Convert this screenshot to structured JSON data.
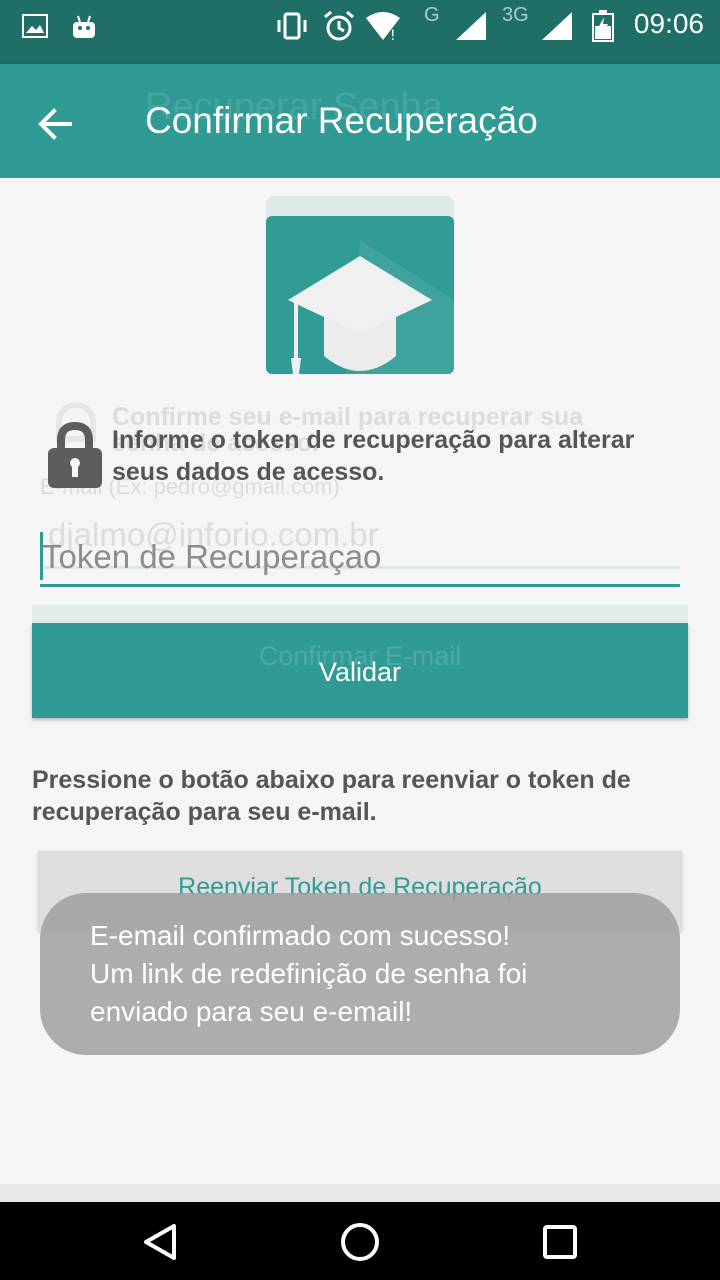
{
  "status_bar": {
    "time": "09:06",
    "network_g": "G",
    "network_3g": "3G",
    "icons": [
      "image-icon",
      "android-icon",
      "vibrate-icon",
      "alarm-icon",
      "wifi-icon",
      "signal-icon",
      "signal-icon",
      "battery-icon"
    ]
  },
  "app_bar": {
    "title": "Confirmar Recuperação",
    "ghost_title": "Recuperar Senha",
    "back_icon": "arrow-back-icon"
  },
  "ghost": {
    "confirm_text_line1": "Confirme seu e-mail para recuperar sua",
    "confirm_text_line2": "senha de acesso.",
    "email_hint": "E-mail (Ex: pedro@gmail.com)",
    "email_value": "djalmo@inforio.com.br",
    "confirm_button": "Confirmar E-mail"
  },
  "main": {
    "info_text": "Informe o token de recuperação para alterar seus dados de acesso.",
    "token_placeholder": "Token de Recuperaçao",
    "validate_button": "Validar",
    "resend_text": "Pressione o botão abaixo para reenviar o token de recuperação para seu e-mail.",
    "resend_button": "Reenviar Token de Recuperação"
  },
  "toast": {
    "message": "E-email confirmado com sucesso!\nUm link de redefinição de senha foi\nenviado para seu e-email!"
  },
  "colors": {
    "status_bar": "#206f67",
    "app_bar": "#309b95",
    "accent": "#309b95",
    "background": "#f5f5f5"
  }
}
